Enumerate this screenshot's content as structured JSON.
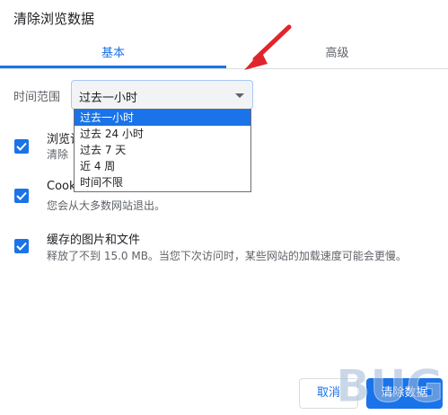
{
  "dialog": {
    "title": "清除浏览数据"
  },
  "tabs": [
    {
      "label": "基本",
      "active": true
    },
    {
      "label": "高级",
      "active": false
    }
  ],
  "time_range": {
    "label": "时间范围",
    "selected": "过去一小时",
    "options": [
      "过去一小时",
      "过去 24 小时",
      "过去 7 天",
      "近 4 周",
      "时间不限"
    ]
  },
  "items": [
    {
      "title": "浏览记",
      "desc": "清除",
      "checked": true
    },
    {
      "title": "Cook",
      "desc": "您会从大多数网站退出。",
      "checked": true
    },
    {
      "title": "缓存的图片和文件",
      "desc": "释放了不到 15.0 MB。当您下次访问时，某些网站的加载速度可能会更慢。",
      "checked": true
    }
  ],
  "buttons": {
    "cancel": "取消",
    "clear": "清除数据"
  },
  "colors": {
    "accent": "#1a73e8",
    "arrow": "#e0262b"
  },
  "watermark": {
    "text": "BUG"
  }
}
